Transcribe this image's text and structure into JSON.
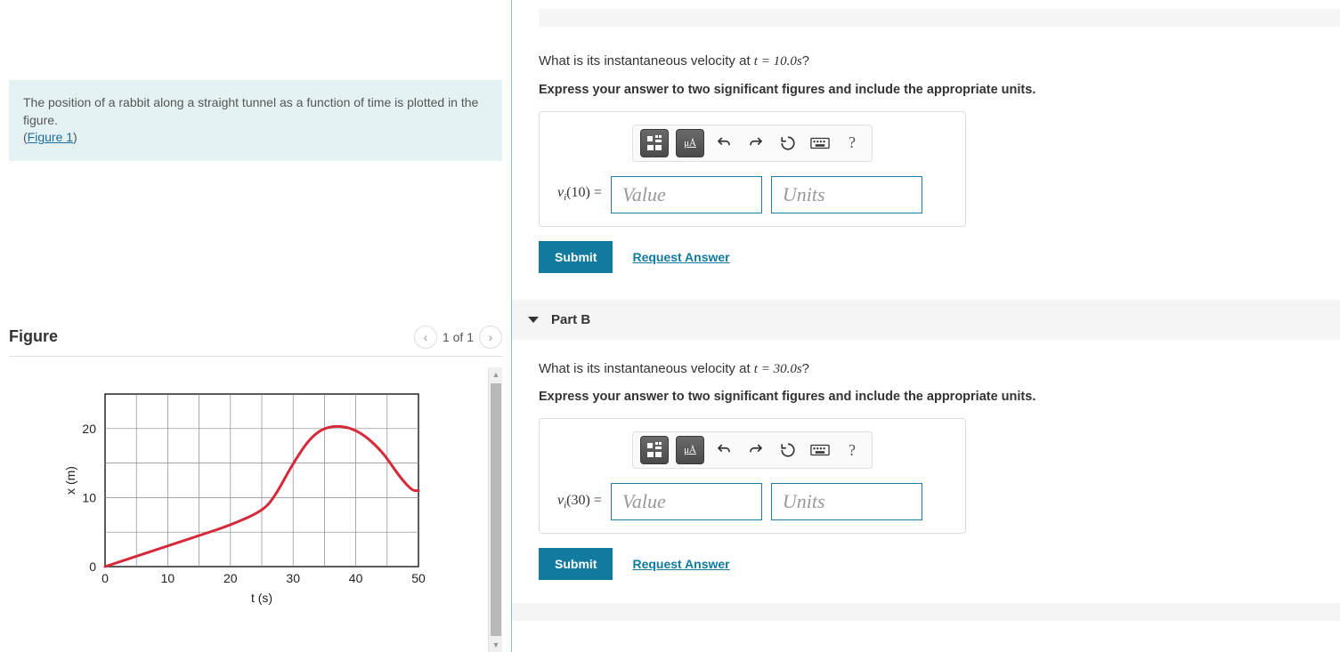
{
  "left": {
    "problem_text_1": "The position of a rabbit along a straight tunnel as a function of time is plotted in the figure.",
    "figure_link": "Figure 1",
    "figure_heading": "Figure",
    "figure_counter": "1 of 1"
  },
  "chart_data": {
    "type": "line",
    "xlabel": "t (s)",
    "ylabel": "x (m)",
    "xlim": [
      0,
      50
    ],
    "ylim": [
      0,
      25
    ],
    "xticks": [
      0,
      10,
      20,
      30,
      40,
      50
    ],
    "yticks": [
      0,
      10,
      20
    ],
    "series": [
      {
        "name": "position",
        "points": [
          [
            0,
            0
          ],
          [
            5,
            1.5
          ],
          [
            10,
            3
          ],
          [
            15,
            4.5
          ],
          [
            20,
            6
          ],
          [
            25,
            8
          ],
          [
            27,
            10
          ],
          [
            30,
            15
          ],
          [
            33,
            19
          ],
          [
            36,
            20.5
          ],
          [
            40,
            20
          ],
          [
            44,
            17
          ],
          [
            47,
            13
          ],
          [
            49,
            11
          ],
          [
            50,
            11
          ]
        ]
      }
    ]
  },
  "partA": {
    "q_prefix": "What is its instantaneous velocity at ",
    "q_var": "t",
    "q_eq": " = 10.0s",
    "q_suffix": "?",
    "instruction": "Express your answer to two significant figures and include the appropriate units.",
    "var_html": "v_i(10) =",
    "value_ph": "Value",
    "units_ph": "Units",
    "submit": "Submit",
    "request": "Request Answer",
    "toolbar": {
      "units_label": "μÅ",
      "help": "?"
    }
  },
  "partB": {
    "header": "Part B",
    "q_prefix": "What is its instantaneous velocity at ",
    "q_var": "t",
    "q_eq": " = 30.0s",
    "q_suffix": "?",
    "instruction": "Express your answer to two significant figures and include the appropriate units.",
    "var_html": "v_i(30) =",
    "value_ph": "Value",
    "units_ph": "Units",
    "submit": "Submit",
    "request": "Request Answer",
    "toolbar": {
      "units_label": "μÅ",
      "help": "?"
    }
  }
}
